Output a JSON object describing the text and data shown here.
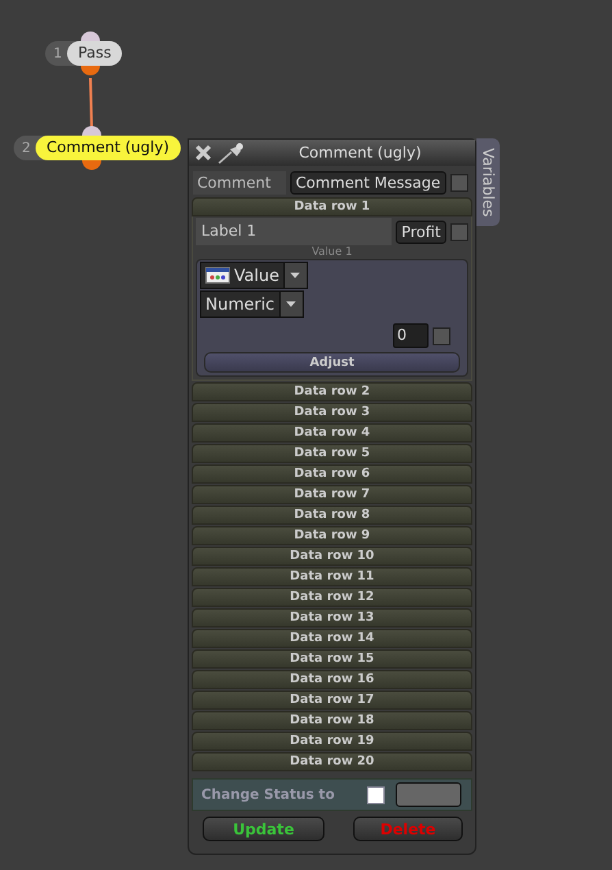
{
  "nodes": [
    {
      "number": "1",
      "label": "Pass",
      "highlighted": false
    },
    {
      "number": "2",
      "label": "Comment (ugly)",
      "highlighted": true
    }
  ],
  "panel": {
    "title": "Comment (ugly)",
    "side_tab": "Variables",
    "comment": {
      "label": "Comment",
      "button": "Comment Message",
      "checked": false
    },
    "data_rows": [
      {
        "title": "Data row 1",
        "expanded": true,
        "label_value": "Label 1",
        "profit_button": "Profit",
        "profit_checked": false,
        "value_caption": "Value 1",
        "value_dropdown": "Value",
        "type_dropdown": "Numeric",
        "number": "0",
        "number_checked": false,
        "adjust_button": "Adjust"
      },
      {
        "title": "Data row 2",
        "expanded": false
      },
      {
        "title": "Data row 3",
        "expanded": false
      },
      {
        "title": "Data row 4",
        "expanded": false
      },
      {
        "title": "Data row 5",
        "expanded": false
      },
      {
        "title": "Data row 6",
        "expanded": false
      },
      {
        "title": "Data row 7",
        "expanded": false
      },
      {
        "title": "Data row 8",
        "expanded": false
      },
      {
        "title": "Data row 9",
        "expanded": false
      },
      {
        "title": "Data row 10",
        "expanded": false
      },
      {
        "title": "Data row 11",
        "expanded": false
      },
      {
        "title": "Data row 12",
        "expanded": false
      },
      {
        "title": "Data row 13",
        "expanded": false
      },
      {
        "title": "Data row 14",
        "expanded": false
      },
      {
        "title": "Data row 15",
        "expanded": false
      },
      {
        "title": "Data row 16",
        "expanded": false
      },
      {
        "title": "Data row 17",
        "expanded": false
      },
      {
        "title": "Data row 18",
        "expanded": false
      },
      {
        "title": "Data row 19",
        "expanded": false
      },
      {
        "title": "Data row 20",
        "expanded": false
      }
    ],
    "status": {
      "label": "Change Status to",
      "checked": false
    },
    "buttons": [
      {
        "label": "Update",
        "kind": "update"
      },
      {
        "label": "Delete",
        "kind": "delete"
      }
    ]
  }
}
